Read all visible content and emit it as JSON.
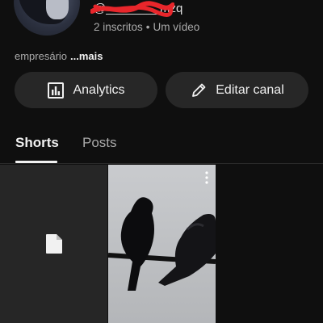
{
  "channel": {
    "handle": "@________mzq",
    "stats": {
      "subscribers": "2 inscritos",
      "separator": "•",
      "videos": "Um vídeo"
    },
    "description": "empresário",
    "more_label": "...mais"
  },
  "buttons": {
    "analytics_label": "Analytics",
    "edit_label": "Editar canal"
  },
  "tabs": [
    {
      "label": "Shorts",
      "active": true
    },
    {
      "label": "Posts",
      "active": false
    }
  ],
  "grid": {
    "tiles": [
      {
        "kind": "file",
        "icon": "file-icon"
      },
      {
        "kind": "short",
        "thumbnail": "pigeons-on-wire"
      },
      {
        "kind": "empty"
      }
    ]
  },
  "colors": {
    "background": "#0f0f0f",
    "button_bg": "#272727",
    "text_primary": "#f1f1f1",
    "text_secondary": "#aaaaaa",
    "redaction": "#e8262b"
  }
}
